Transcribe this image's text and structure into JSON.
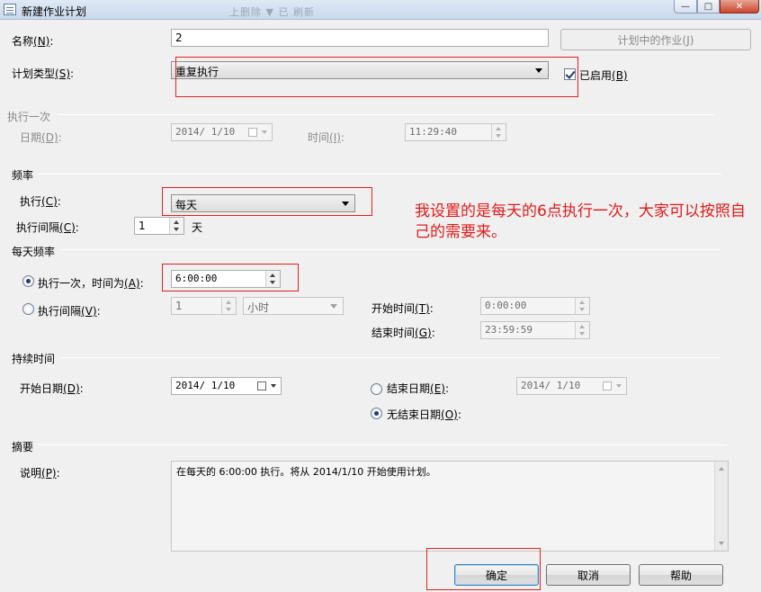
{
  "window": {
    "title": "新建作业计划",
    "ghost_menu": "上删除  ▼ 已  刷新",
    "minimize": "—",
    "maximize": "□",
    "close": "✕"
  },
  "name_row": {
    "label": "名称",
    "accel": "(N)",
    "colon": ":",
    "value": "2",
    "jobs_button": "计划中的作业(J)"
  },
  "type_row": {
    "label": "计划类型",
    "accel": "(S)",
    "colon": ":",
    "selected": "重复执行",
    "enabled_label": "已启用",
    "enabled_accel": "(B)",
    "enabled_checked": true
  },
  "once": {
    "header": "执行一次",
    "date_label": "日期",
    "date_accel": "(D)",
    "colon": ":",
    "date_value": "2014/ 1/10",
    "time_label": "时间",
    "time_accel": "(I)",
    "time_value": "11:29:40"
  },
  "frequency": {
    "header": "频率",
    "exec_label": "执行",
    "exec_accel": "(C)",
    "colon": ":",
    "exec_value": "每天",
    "interval_label": "执行间隔",
    "interval_accel": "(C)",
    "interval_value": "1",
    "interval_unit": "天"
  },
  "daily": {
    "header": "每天频率",
    "once_label": "执行一次，时间为",
    "once_accel": "(A)",
    "once_value": "6:00:00",
    "once_selected": true,
    "every_label": "执行间隔",
    "every_accel": "(V)",
    "every_value": "1",
    "every_unit": "小时",
    "start_label": "开始时间",
    "start_accel": "(T)",
    "start_value": "0:00:00",
    "end_label": "结束时间",
    "end_accel": "(G)",
    "end_value": "23:59:59",
    "colon": ":"
  },
  "duration": {
    "header": "持续时间",
    "start_label": "开始日期",
    "start_accel": "(D)",
    "start_value": "2014/ 1/10",
    "end_label": "结束日期",
    "end_accel": "(E)",
    "end_value": "2014/ 1/10",
    "no_end_label": "无结束日期",
    "no_end_accel": "(O)",
    "no_end_selected": true,
    "colon": ":"
  },
  "summary": {
    "header": "摘要",
    "desc_label": "说明",
    "desc_accel": "(P)",
    "colon": ":",
    "desc_text": "在每天的 6:00:00 执行。将从 2014/1/10 开始使用计划。"
  },
  "buttons": {
    "ok": "确定",
    "cancel": "取消",
    "help": "帮助"
  },
  "annotation": {
    "text": "我设置的是每天的6点执行一次，大家可以按照自己的需要来。",
    "color": "#e11a1a"
  }
}
